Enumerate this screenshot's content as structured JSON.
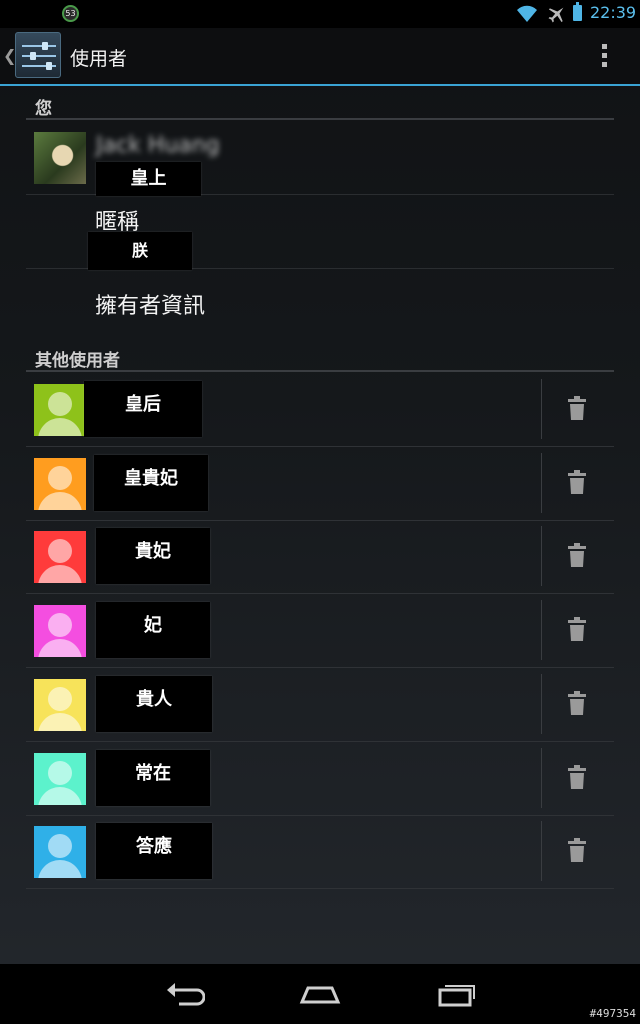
{
  "status_bar": {
    "notification_count": "53",
    "time": "22:39"
  },
  "action_bar": {
    "title": "使用者"
  },
  "you_section": {
    "header": "您",
    "owner_name_blurred": "Jack Huang",
    "owner_name_redaction": "皇上",
    "nickname_label": "暱稱",
    "nickname_redaction": "朕",
    "owner_info_label": "擁有者資訊"
  },
  "other_section": {
    "header": "其他使用者",
    "users": [
      {
        "name": "皇后",
        "color": "#8ec21a"
      },
      {
        "name": "皇貴妃",
        "color": "#ff9d1f"
      },
      {
        "name": "貴妃",
        "color": "#ff3b3b"
      },
      {
        "name": "妃",
        "color": "#f44ee0"
      },
      {
        "name": "貴人",
        "color": "#f7e35a"
      },
      {
        "name": "常在",
        "color": "#5cf2cc"
      },
      {
        "name": "答應",
        "color": "#2fb0e8"
      }
    ]
  },
  "watermark": "#497354"
}
